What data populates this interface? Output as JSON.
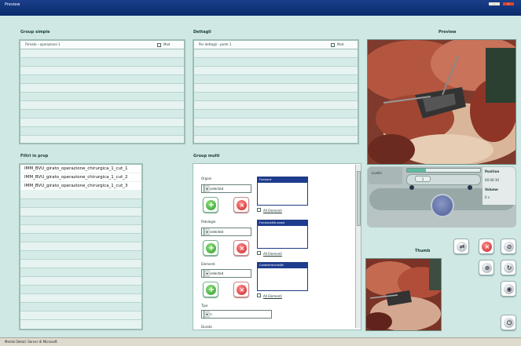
{
  "window": {
    "title": "Preview",
    "min_label": "---",
    "close_label": "X"
  },
  "group_simple": {
    "title": "Group simple",
    "header": "Filmato - operazione 1",
    "checkbox_label": "Mod"
  },
  "details": {
    "title": "Dettagli",
    "header": "Per dettagli - parte 1",
    "checkbox_label": "Mod"
  },
  "preview": {
    "title": "Preview"
  },
  "filter_group": {
    "title": "Filtri in prop",
    "items": [
      "IMM_BVU_girato_operazione_chirurgica_1_cut_1",
      "IMM_BVU_girato_operazione_chirurgica_1_cut_2",
      "IMM_BVU_girato_operazione_chirurgica_1_cut_3"
    ]
  },
  "group_multi": {
    "title": "Group multi",
    "organs": {
      "label": "Organi",
      "selected": "Not selected",
      "list_header": "Funzione",
      "all_label": "All Elementi"
    },
    "pathologies": {
      "label": "Patologie",
      "selected": "Not selected",
      "list_header": "Funzionalità ossea",
      "all_label": "All Elementi"
    },
    "elements": {
      "label": "Elementi",
      "selected": "Not selected",
      "list_header": "Caratteristiche/Bt",
      "all_label": "All Elementi"
    },
    "type": {
      "label": "Tipo",
      "selected": "Open"
    },
    "duration": {
      "label": "Durata"
    }
  },
  "player": {
    "left_label": "Livello",
    "position_label": "Position",
    "time": "00:00:10",
    "volume_label": "Volume",
    "volume_value": "0 s",
    "zoom_level": "1"
  },
  "thumbnail": {
    "title": "Thumb"
  },
  "statusbar": {
    "text": "Mental Detail: Server di Microsoft"
  }
}
